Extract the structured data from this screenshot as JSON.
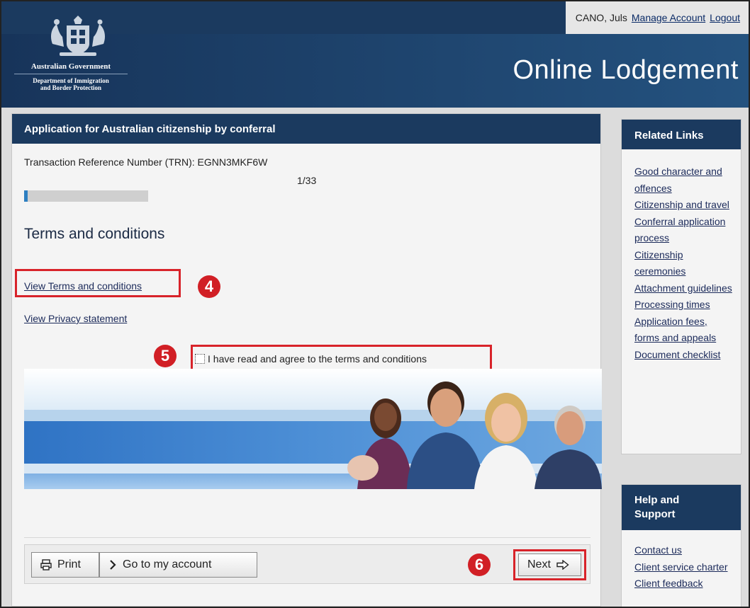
{
  "header": {
    "user_name": "CANO, Juls",
    "manage_account": "Manage Account",
    "logout": "Logout",
    "gov_line1": "Australian Government",
    "gov_line2": "Department of Immigration",
    "gov_line3": "and Border Protection",
    "title": "Online Lodgement"
  },
  "main": {
    "heading": "Application for Australian citizenship by conferral",
    "trn": "Transaction Reference Number (TRN): EGNN3MKF6W",
    "step": "1/33",
    "progress_fraction": 0.0303,
    "section_title": "Terms and conditions",
    "terms_link": "View Terms and conditions",
    "privacy_link": "View Privacy statement",
    "agree_label": "I have read and agree to the terms and conditions",
    "agree_checked": false,
    "badge4": "4",
    "badge5": "5",
    "badge6": "6"
  },
  "buttons": {
    "print": "Print",
    "go_account": "Go to my account",
    "next": "Next"
  },
  "related": {
    "heading": "Related Links",
    "items": [
      "Good character and offences",
      "Citizenship and travel",
      "Conferral application process",
      "Citizenship ceremonies",
      "Attachment guidelines",
      "Processing times",
      "Application fees, forms and appeals",
      "Document checklist"
    ]
  },
  "help": {
    "heading_line1": "Help and",
    "heading_line2": "Support",
    "items": [
      "Contact us",
      "Client service charter",
      "Client feedback"
    ]
  },
  "colors": {
    "navy": "#1b3a5f",
    "annotation_red": "#d8232a",
    "progress_blue": "#2d7fc1"
  }
}
